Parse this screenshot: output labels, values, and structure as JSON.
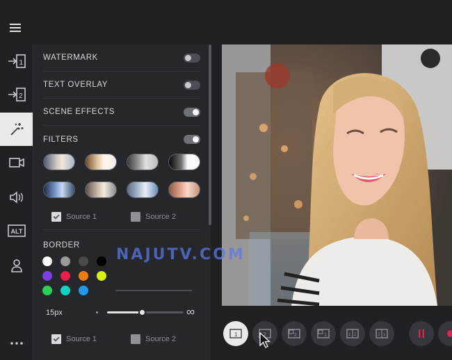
{
  "panel": {
    "watermark_label": "WATERMARK",
    "watermark_on": false,
    "text_overlay_label": "TEXT OVERLAY",
    "text_overlay_on": false,
    "scene_effects_label": "SCENE EFFECTS",
    "scene_effects_on": true,
    "filters_label": "FILTERS",
    "filters_on": true,
    "filter_sources": [
      {
        "label": "Source 1",
        "checked": true
      },
      {
        "label": "Source 2",
        "checked": false
      }
    ],
    "border_label": "BORDER",
    "border_colors": [
      "#ffffff",
      "#9a9a9a",
      "#4b4b4b",
      "#000000",
      "#7b3fe4",
      "#e8214c",
      "#f07a0f",
      "#d7f20f",
      "#2bd15a",
      "#13d2c4",
      "#1e9be6"
    ],
    "border_size": "15px",
    "border_size_fraction": 0.45,
    "infinity_symbol": "∞",
    "border_sources": [
      {
        "label": "Source 1",
        "checked": true
      },
      {
        "label": "Source 2",
        "checked": false
      }
    ]
  },
  "rail": {
    "items": [
      "input-1-icon",
      "input-2-icon",
      "magic-wand-icon",
      "camera-icon",
      "speaker-icon",
      "alt-text-icon",
      "user-icon",
      "more-icon"
    ],
    "alt_text": "ALT",
    "active": "magic-wand-icon"
  },
  "watermark_overlay": "NAJUTV.COM",
  "scene_bar": {
    "buttons": [
      "layout-single-1",
      "layout-single-2",
      "layout-pip-1-2",
      "layout-pip-2-1",
      "layout-split-1-2",
      "layout-split-2-1",
      "pause"
    ],
    "active": "layout-single-1",
    "accent": "#e8214c"
  }
}
